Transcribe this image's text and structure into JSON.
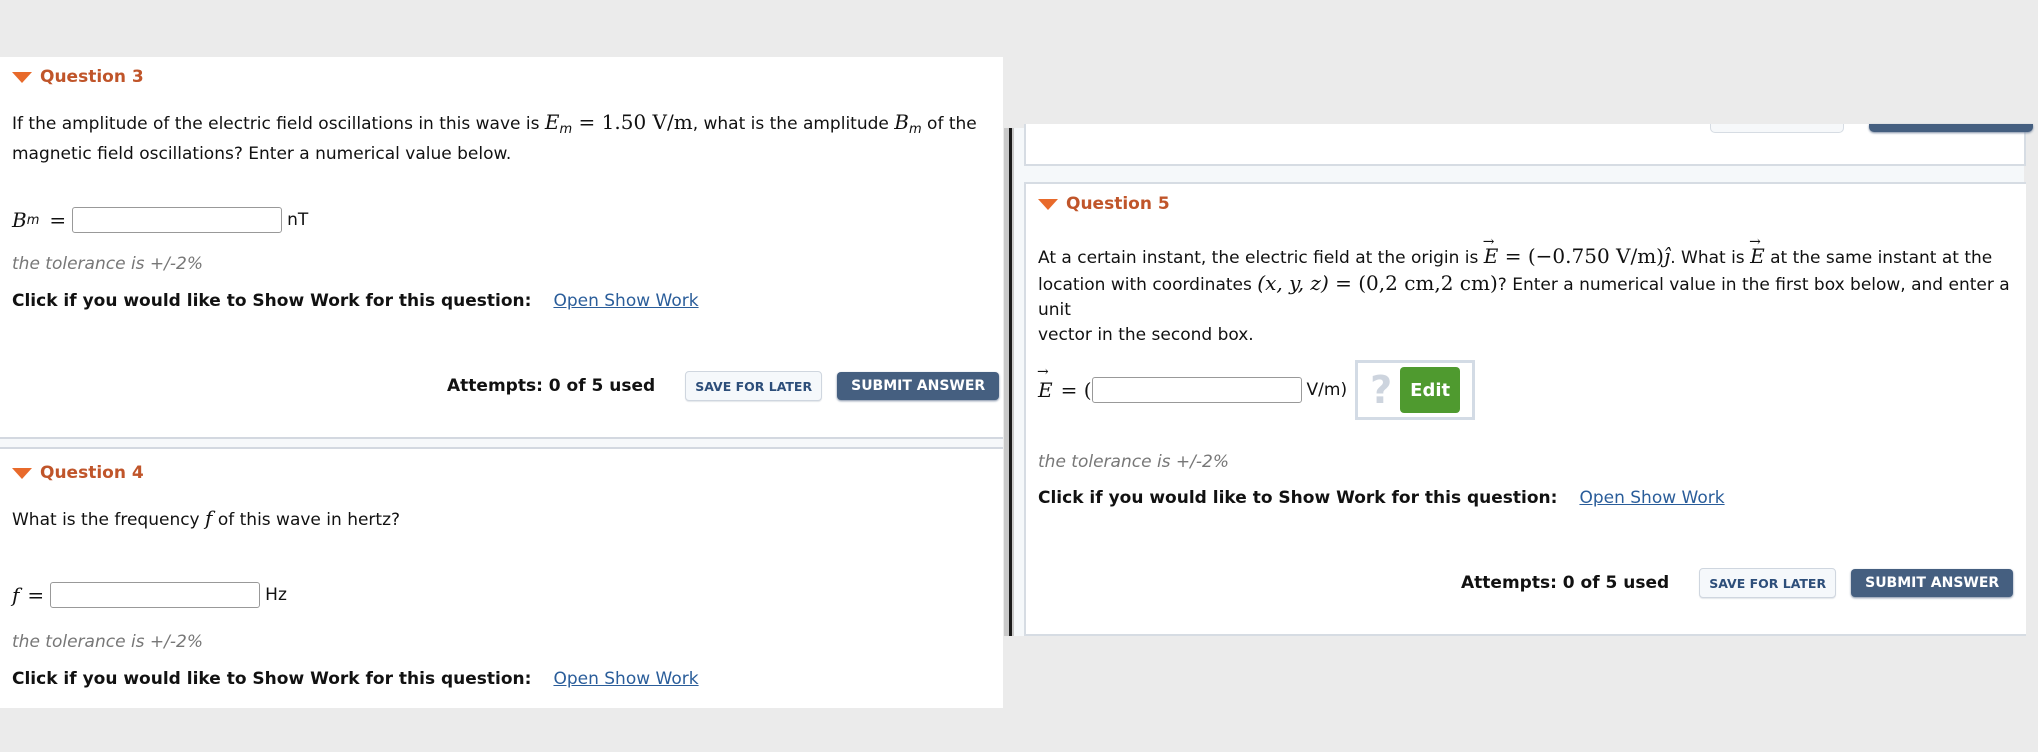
{
  "colors": {
    "background": "#ebebeb",
    "question_title": "#c0552a",
    "triangle": "#e86a2b",
    "link": "#2a5d9a",
    "submit_button": "#455f80",
    "edit_button": "#4f9a2f",
    "tolerance_text": "#777777"
  },
  "question3": {
    "title": "Question 3",
    "prompt_part1": "If the amplitude of the electric field oscillations in this wave is ",
    "math_Em_var": "E",
    "math_Em_sub": "m",
    "math_Em_value": " = 1.50 V/m",
    "prompt_part2": ", what is the amplitude ",
    "math_Bm_var": "B",
    "math_Bm_sub": "m",
    "prompt_part3": " of the",
    "prompt_line2": "magnetic field oscillations? Enter a numerical value below.",
    "answer_var": "B",
    "answer_sub": "m",
    "answer_eq": "=",
    "answer_value": "",
    "unit": "nT",
    "tolerance": "the tolerance is +/-2%",
    "show_work_label": "Click if you would like to Show Work for this question:",
    "show_work_link": "Open Show Work",
    "attempts": "Attempts: 0 of 5 used",
    "save_label": "SAVE FOR LATER",
    "submit_label": "SUBMIT ANSWER"
  },
  "question4": {
    "title": "Question 4",
    "prompt_part1": "What is the frequency ",
    "math_var": "f",
    "prompt_part2": " of this wave in hertz?",
    "answer_var": "f",
    "answer_eq": "=",
    "answer_value": "",
    "unit": "Hz",
    "tolerance": "the tolerance is +/-2%",
    "show_work_label": "Click if you would like to Show Work for this question:",
    "show_work_link": "Open Show Work"
  },
  "question5": {
    "title": "Question 5",
    "prompt_part1": "At a certain instant, the electric field at the origin is ",
    "math_E_var": "E",
    "math_E_value": " = (−0.750 V/m)",
    "math_jhat": "ĵ",
    "prompt_part2": ". What is ",
    "math_E2_var": "E",
    "prompt_part3": " at the same instant at the",
    "prompt_line2_part1": "location with coordinates ",
    "math_coords": "(x, y, z)",
    "math_coords_value": " = (0,2 cm,2 cm)",
    "prompt_line2_part2": "? Enter a numerical value in the first box below, and enter a unit",
    "prompt_line3": "vector in the second box.",
    "answer_var": "E",
    "answer_eq": "= (",
    "answer_value": "",
    "unit": "V/m)",
    "unit_vector_placeholder_icon": "?",
    "edit_label": "Edit",
    "tolerance": "the tolerance is +/-2%",
    "show_work_label": "Click if you would like to Show Work for this question:",
    "show_work_link": "Open Show Work",
    "attempts": "Attempts: 0 of 5 used",
    "save_label": "SAVE FOR LATER",
    "submit_label": "SUBMIT ANSWER"
  }
}
